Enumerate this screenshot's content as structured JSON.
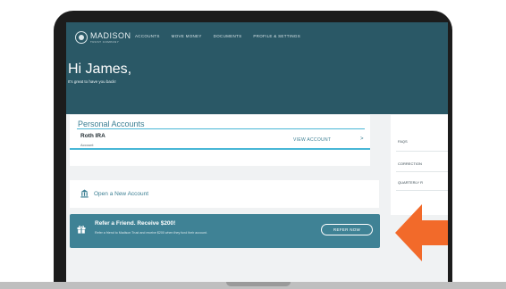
{
  "header": {
    "logo": {
      "name": "MADISON",
      "sub": "TRUST COMPANY"
    },
    "nav": [
      "ACCOUNTS",
      "MOVE MONEY",
      "DOCUMENTS",
      "PROFILE & SETTINGS"
    ],
    "greeting": "Hi James,",
    "subgreeting": "It's great to have you back!"
  },
  "accounts": {
    "title": "Personal Accounts",
    "account_name": "Roth IRA",
    "account_sub": "Account",
    "view_label": "VIEW ACCOUNT",
    "chevron": ">"
  },
  "side": {
    "faq": "FAQS",
    "corrections": "CORRECTION",
    "quarterly": "QUARTERLY R"
  },
  "open_account": {
    "label": "Open a New Account"
  },
  "refer": {
    "title": "Refer a Friend. Receive $200!",
    "subtitle": "Refer a friend to Madison Trust and receive $200 when they fund their account.",
    "button": "REFER NOW"
  },
  "colors": {
    "header_bg": "#2a5866",
    "accent": "#3c7f93",
    "rule": "#47b6d6",
    "banner_bg": "#3f8295",
    "arrow": "#f26a2a"
  },
  "icons": {
    "logo": "madison-logo-icon",
    "bank": "bank-icon",
    "gift": "gift-icon",
    "arrow": "left-arrow-icon"
  }
}
